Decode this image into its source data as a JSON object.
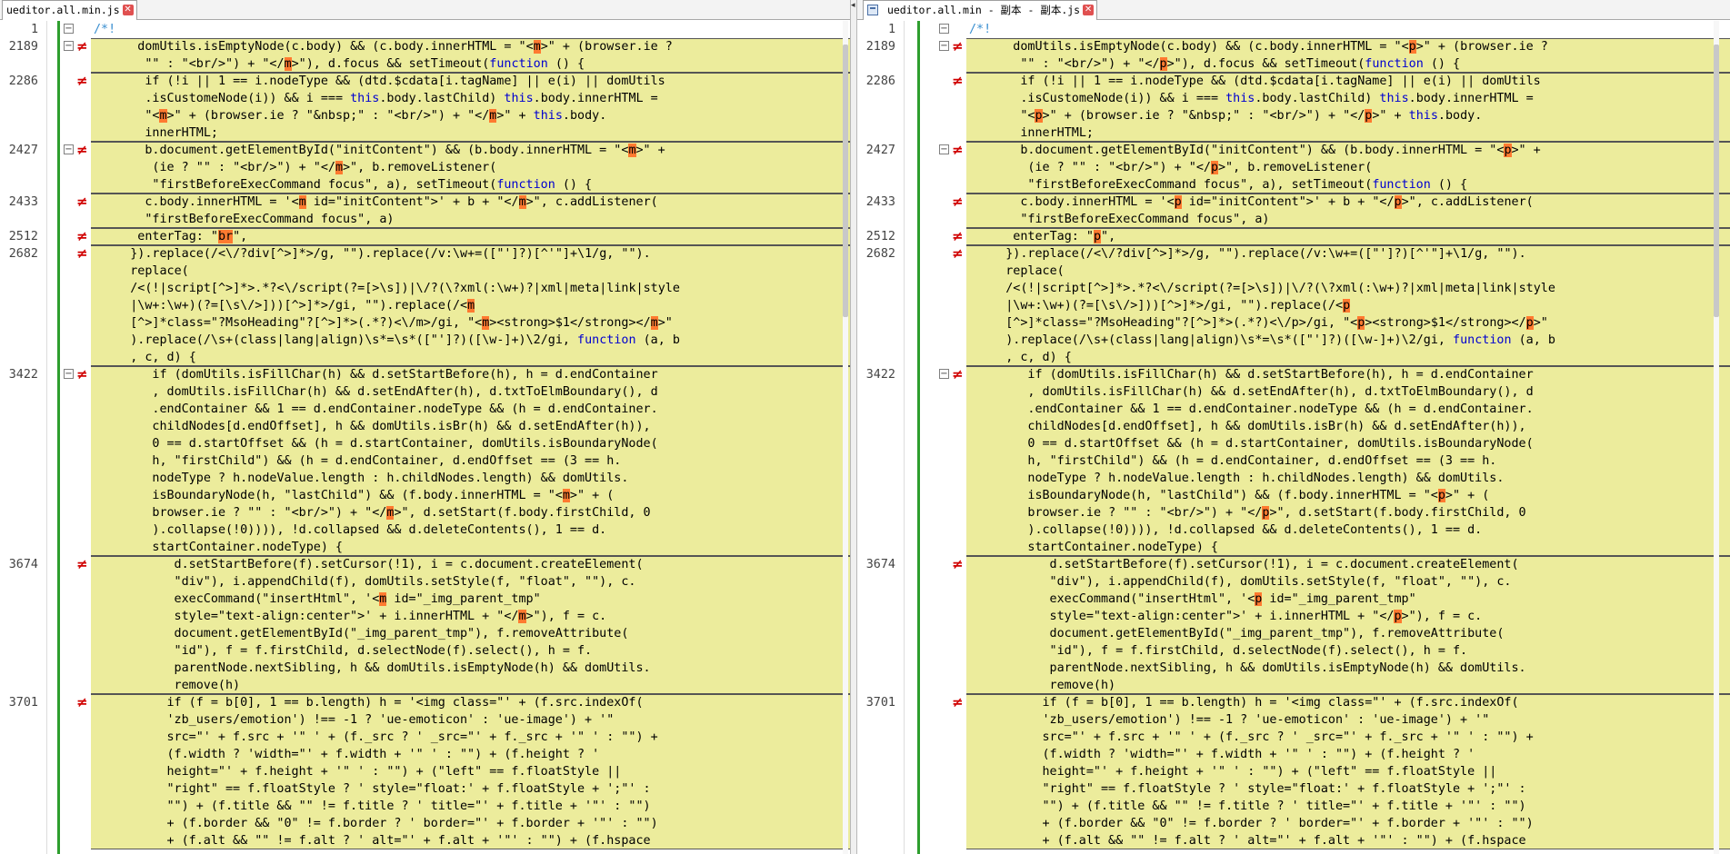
{
  "left": {
    "tab_label": "ueditor.all.min.js",
    "lines": [
      {
        "num": "1",
        "text": "/*!",
        "diff": false
      },
      {
        "num": "2189",
        "text": "domUtils.isEmptyNode(c.body) && (c.body.innerHTML = \"<m>\" + (browser.ie ?",
        "diff": true
      },
      {
        "num": "",
        "text": "\"\" : \"<br/>\") + \"</m>\"), d.focus && setTimeout(function () {",
        "diff": true
      },
      {
        "num": "2286",
        "text": "if (!i || 1 == i.nodeType && (dtd.$cdata[i.tagName] || e(i) || domUtils",
        "diff": true
      },
      {
        "num": "",
        "text": ".isCustomeNode(i)) && i === this.body.lastChild) this.body.innerHTML =",
        "diff": true
      },
      {
        "num": "",
        "text": "\"<m>\" + (browser.ie ? \"&nbsp;\" : \"<br/>\") + \"</m>\" + this.body.",
        "diff": true
      },
      {
        "num": "",
        "text": "innerHTML;",
        "diff": true
      },
      {
        "num": "2427",
        "text": "b.document.getElementById(\"initContent\") && (b.body.innerHTML = \"<m>\" +",
        "diff": true
      },
      {
        "num": "",
        "text": "(ie ? \"\" : \"<br/>\") + \"</m>\", b.removeListener(",
        "diff": true
      },
      {
        "num": "",
        "text": "\"firstBeforeExecCommand focus\", a), setTimeout(function () {",
        "diff": true
      },
      {
        "num": "2433",
        "text": "c.body.innerHTML = '<m id=\"initContent\">' + b + \"</m>\", c.addListener(",
        "diff": true
      },
      {
        "num": "",
        "text": "\"firstBeforeExecCommand focus\", a)",
        "diff": true
      },
      {
        "num": "2512",
        "text": "enterTag: \"br\",",
        "diff": true
      },
      {
        "num": "2682",
        "text": "}).replace(/<\\/?div[^>]*>/g, \"\").replace(/v:\\w+=([\"']?)[^'\"]+\\1/g, \"\").",
        "diff": true
      },
      {
        "num": "",
        "text": "replace(",
        "diff": true
      },
      {
        "num": "",
        "text": "/<(!|script[^>]*>.*?<\\/script(?=[>\\s])|\\/?(\\?xml(:\\w+)?|xml|meta|link|style",
        "diff": true
      },
      {
        "num": "",
        "text": "|\\w+:\\w+)(?=[\\s\\/>]))[^>]*>/gi, \"\").replace(/<m",
        "diff": true
      },
      {
        "num": "",
        "text": "[^>]*class=\"?MsoHeading\"?[^>]*>(.*?)<\\/m>/gi, \"<m><strong>$1</strong></m>\"",
        "diff": true
      },
      {
        "num": "",
        "text": ").replace(/\\s+(class|lang|align)\\s*=\\s*([\"']?)([\\w-]+)\\2/gi, function (a, b",
        "diff": true
      },
      {
        "num": "",
        "text": ", c, d) {",
        "diff": true
      },
      {
        "num": "3422",
        "text": "if (domUtils.isFillChar(h) && d.setStartBefore(h), h = d.endContainer",
        "diff": true
      },
      {
        "num": "",
        "text": ", domUtils.isFillChar(h) && d.setEndAfter(h), d.txtToElmBoundary(), d",
        "diff": true
      },
      {
        "num": "",
        "text": ".endContainer && 1 == d.endContainer.nodeType && (h = d.endContainer.",
        "diff": true
      },
      {
        "num": "",
        "text": "childNodes[d.endOffset], h && domUtils.isBr(h) && d.setEndAfter(h)),",
        "diff": true
      },
      {
        "num": "",
        "text": "0 == d.startOffset && (h = d.startContainer, domUtils.isBoundaryNode(",
        "diff": true
      },
      {
        "num": "",
        "text": "h, \"firstChild\") && (h = d.endContainer, d.endOffset == (3 == h.",
        "diff": true
      },
      {
        "num": "",
        "text": "nodeType ? h.nodeValue.length : h.childNodes.length) && domUtils.",
        "diff": true
      },
      {
        "num": "",
        "text": "isBoundaryNode(h, \"lastChild\") && (f.body.innerHTML = \"<m>\" + (",
        "diff": true
      },
      {
        "num": "",
        "text": "browser.ie ? \"\" : \"<br/>\") + \"</m>\", d.setStart(f.body.firstChild, 0",
        "diff": true
      },
      {
        "num": "",
        "text": ").collapse(!0)))), !d.collapsed && d.deleteContents(), 1 == d.",
        "diff": true
      },
      {
        "num": "",
        "text": "startContainer.nodeType) {",
        "diff": true
      },
      {
        "num": "3674",
        "text": "d.setStartBefore(f).setCursor(!1), i = c.document.createElement(",
        "diff": true
      },
      {
        "num": "",
        "text": "\"div\"), i.appendChild(f), domUtils.setStyle(f, \"float\", \"\"), c.",
        "diff": true
      },
      {
        "num": "",
        "text": "execCommand(\"insertHtml\", '<m id=\"_img_parent_tmp\"",
        "diff": true
      },
      {
        "num": "",
        "text": "style=\"text-align:center\">' + i.innerHTML + \"</m>\"), f = c.",
        "diff": true
      },
      {
        "num": "",
        "text": "document.getElementById(\"_img_parent_tmp\"), f.removeAttribute(",
        "diff": true
      },
      {
        "num": "",
        "text": "\"id\"), f = f.firstChild, d.selectNode(f).select(), h = f.",
        "diff": true
      },
      {
        "num": "",
        "text": "parentNode.nextSibling, h && domUtils.isEmptyNode(h) && domUtils.",
        "diff": true
      },
      {
        "num": "",
        "text": "remove(h)",
        "diff": true
      },
      {
        "num": "3701",
        "text": "if (f = b[0], 1 == b.length) h = '<img class=\"' + (f.src.indexOf(",
        "diff": true
      },
      {
        "num": "",
        "text": "'zb_users/emotion') !== -1 ? 'ue-emoticon' : 'ue-image') + '\"",
        "diff": true
      },
      {
        "num": "",
        "text": "src=\"' + f.src + '\" ' + (f._src ? ' _src=\"' + f._src + '\" ' : \"\") +",
        "diff": true
      },
      {
        "num": "",
        "text": "(f.width ? 'width=\"' + f.width + '\" ' : \"\") + (f.height ? '",
        "diff": true
      },
      {
        "num": "",
        "text": "height=\"' + f.height + '\" ' : \"\") + (\"left\" == f.floatStyle ||",
        "diff": true
      },
      {
        "num": "",
        "text": "\"right\" == f.floatStyle ? ' style=\"float:' + f.floatStyle + ';\"' :",
        "diff": true
      },
      {
        "num": "",
        "text": "\"\") + (f.title && \"\" != f.title ? ' title=\"' + f.title + '\"' : \"\")",
        "diff": true
      },
      {
        "num": "",
        "text": "+ (f.border && \"0\" != f.border ? ' border=\"' + f.border + '\"' : \"\")",
        "diff": true
      },
      {
        "num": "",
        "text": "+ (f.alt && \"\" != f.alt ? ' alt=\"' + f.alt + '\"' : \"\") + (f.hspace",
        "diff": true
      }
    ]
  },
  "right": {
    "tab_label": "ueditor.all.min - 副本 - 副本.js",
    "lines": [
      {
        "num": "1",
        "text": "/*!",
        "diff": false
      },
      {
        "num": "2189",
        "text": "domUtils.isEmptyNode(c.body) && (c.body.innerHTML = \"<p>\" + (browser.ie ?",
        "diff": true
      },
      {
        "num": "",
        "text": "\"\" : \"<br/>\") + \"</p>\"), d.focus && setTimeout(function () {",
        "diff": true
      },
      {
        "num": "2286",
        "text": "if (!i || 1 == i.nodeType && (dtd.$cdata[i.tagName] || e(i) || domUtils",
        "diff": true
      },
      {
        "num": "",
        "text": ".isCustomeNode(i)) && i === this.body.lastChild) this.body.innerHTML =",
        "diff": true
      },
      {
        "num": "",
        "text": "\"<p>\" + (browser.ie ? \"&nbsp;\" : \"<br/>\") + \"</p>\" + this.body.",
        "diff": true
      },
      {
        "num": "",
        "text": "innerHTML;",
        "diff": true
      },
      {
        "num": "2427",
        "text": "b.document.getElementById(\"initContent\") && (b.body.innerHTML = \"<p>\" +",
        "diff": true
      },
      {
        "num": "",
        "text": "(ie ? \"\" : \"<br/>\") + \"</p>\", b.removeListener(",
        "diff": true
      },
      {
        "num": "",
        "text": "\"firstBeforeExecCommand focus\", a), setTimeout(function () {",
        "diff": true
      },
      {
        "num": "2433",
        "text": "c.body.innerHTML = '<p id=\"initContent\">' + b + \"</p>\", c.addListener(",
        "diff": true
      },
      {
        "num": "",
        "text": "\"firstBeforeExecCommand focus\", a)",
        "diff": true
      },
      {
        "num": "2512",
        "text": "enterTag: \"p\",",
        "diff": true
      },
      {
        "num": "2682",
        "text": "}).replace(/<\\/?div[^>]*>/g, \"\").replace(/v:\\w+=([\"']?)[^'\"]+\\1/g, \"\").",
        "diff": true
      },
      {
        "num": "",
        "text": "replace(",
        "diff": true
      },
      {
        "num": "",
        "text": "/<(!|script[^>]*>.*?<\\/script(?=[>\\s])|\\/?(\\?xml(:\\w+)?|xml|meta|link|style",
        "diff": true
      },
      {
        "num": "",
        "text": "|\\w+:\\w+)(?=[\\s\\/>]))[^>]*>/gi, \"\").replace(/<p",
        "diff": true
      },
      {
        "num": "",
        "text": "[^>]*class=\"?MsoHeading\"?[^>]*>(.*?)<\\/p>/gi, \"<p><strong>$1</strong></p>\"",
        "diff": true
      },
      {
        "num": "",
        "text": ").replace(/\\s+(class|lang|align)\\s*=\\s*([\"']?)([\\w-]+)\\2/gi, function (a, b",
        "diff": true
      },
      {
        "num": "",
        "text": ", c, d) {",
        "diff": true
      },
      {
        "num": "3422",
        "text": "if (domUtils.isFillChar(h) && d.setStartBefore(h), h = d.endContainer",
        "diff": true
      },
      {
        "num": "",
        "text": ", domUtils.isFillChar(h) && d.setEndAfter(h), d.txtToElmBoundary(), d",
        "diff": true
      },
      {
        "num": "",
        "text": ".endContainer && 1 == d.endContainer.nodeType && (h = d.endContainer.",
        "diff": true
      },
      {
        "num": "",
        "text": "childNodes[d.endOffset], h && domUtils.isBr(h) && d.setEndAfter(h)),",
        "diff": true
      },
      {
        "num": "",
        "text": "0 == d.startOffset && (h = d.startContainer, domUtils.isBoundaryNode(",
        "diff": true
      },
      {
        "num": "",
        "text": "h, \"firstChild\") && (h = d.endContainer, d.endOffset == (3 == h.",
        "diff": true
      },
      {
        "num": "",
        "text": "nodeType ? h.nodeValue.length : h.childNodes.length) && domUtils.",
        "diff": true
      },
      {
        "num": "",
        "text": "isBoundaryNode(h, \"lastChild\") && (f.body.innerHTML = \"<p>\" + (",
        "diff": true
      },
      {
        "num": "",
        "text": "browser.ie ? \"\" : \"<br/>\") + \"</p>\", d.setStart(f.body.firstChild, 0",
        "diff": true
      },
      {
        "num": "",
        "text": ").collapse(!0)))), !d.collapsed && d.deleteContents(), 1 == d.",
        "diff": true
      },
      {
        "num": "",
        "text": "startContainer.nodeType) {",
        "diff": true
      },
      {
        "num": "3674",
        "text": "d.setStartBefore(f).setCursor(!1), i = c.document.createElement(",
        "diff": true
      },
      {
        "num": "",
        "text": "\"div\"), i.appendChild(f), domUtils.setStyle(f, \"float\", \"\"), c.",
        "diff": true
      },
      {
        "num": "",
        "text": "execCommand(\"insertHtml\", '<p id=\"_img_parent_tmp\"",
        "diff": true
      },
      {
        "num": "",
        "text": "style=\"text-align:center\">' + i.innerHTML + \"</p>\"), f = c.",
        "diff": true
      },
      {
        "num": "",
        "text": "document.getElementById(\"_img_parent_tmp\"), f.removeAttribute(",
        "diff": true
      },
      {
        "num": "",
        "text": "\"id\"), f = f.firstChild, d.selectNode(f).select(), h = f.",
        "diff": true
      },
      {
        "num": "",
        "text": "parentNode.nextSibling, h && domUtils.isEmptyNode(h) && domUtils.",
        "diff": true
      },
      {
        "num": "",
        "text": "remove(h)",
        "diff": true
      },
      {
        "num": "3701",
        "text": "if (f = b[0], 1 == b.length) h = '<img class=\"' + (f.src.indexOf(",
        "diff": true
      },
      {
        "num": "",
        "text": "'zb_users/emotion') !== -1 ? 'ue-emoticon' : 'ue-image') + '\"",
        "diff": true
      },
      {
        "num": "",
        "text": "src=\"' + f.src + '\" ' + (f._src ? ' _src=\"' + f._src + '\" ' : \"\") +",
        "diff": true
      },
      {
        "num": "",
        "text": "(f.width ? 'width=\"' + f.width + '\" ' : \"\") + (f.height ? '",
        "diff": true
      },
      {
        "num": "",
        "text": "height=\"' + f.height + '\" ' : \"\") + (\"left\" == f.floatStyle ||",
        "diff": true
      },
      {
        "num": "",
        "text": "\"right\" == f.floatStyle ? ' style=\"float:' + f.floatStyle + ';\"' :",
        "diff": true
      },
      {
        "num": "",
        "text": "\"\") + (f.title && \"\" != f.title ? ' title=\"' + f.title + '\"' : \"\")",
        "diff": true
      },
      {
        "num": "",
        "text": "+ (f.border && \"0\" != f.border ? ' border=\"' + f.border + '\"' : \"\")",
        "diff": true
      },
      {
        "num": "",
        "text": "+ (f.alt && \"\" != f.alt ? ' alt=\"' + f.alt + '\"' : \"\") + (f.hspace",
        "diff": true
      }
    ]
  },
  "diff_marker": "≠",
  "fold_symbol": "⊟",
  "close_symbol": "✕",
  "splitter_arrow": "◂",
  "colors": {
    "diff_bg": "#ecec9c",
    "diff_mark": "#d00000",
    "separator": "#2e9e2e",
    "highlight": "#ff7a30",
    "keyword": "#0000d0"
  }
}
